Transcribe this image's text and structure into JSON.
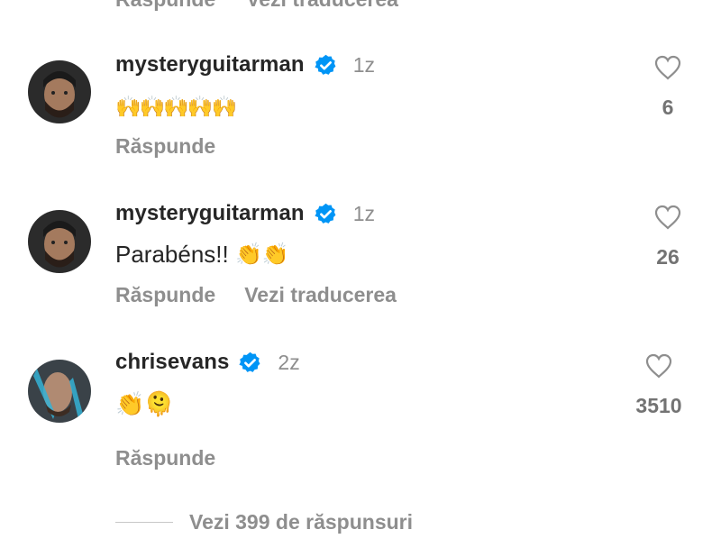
{
  "top_actions": {
    "reply": "Răspunde",
    "translate": "Vezi traducerea"
  },
  "comments": [
    {
      "username": "mysteryguitarman",
      "time": "1z",
      "text": "",
      "emoji": "🙌🙌🙌🙌🙌",
      "likes": "6",
      "reply_label": "Răspunde",
      "translate_label": ""
    },
    {
      "username": "mysteryguitarman",
      "time": "1z",
      "text": "Parabéns!! ",
      "emoji": "👏👏",
      "likes": "26",
      "reply_label": "Răspunde",
      "translate_label": "Vezi traducerea"
    },
    {
      "username": "chrisevans",
      "time": "2z",
      "text": "",
      "emoji": "👏🫠",
      "likes": "3510",
      "reply_label": "Răspunde",
      "translate_label": ""
    }
  ],
  "view_replies": "Vezi 399 de răspunsuri",
  "colors": {
    "verified": "#0095f6",
    "muted": "#8e8e8e",
    "text": "#262626"
  },
  "icons": [
    "verified-badge-icon",
    "heart-outline-icon"
  ]
}
